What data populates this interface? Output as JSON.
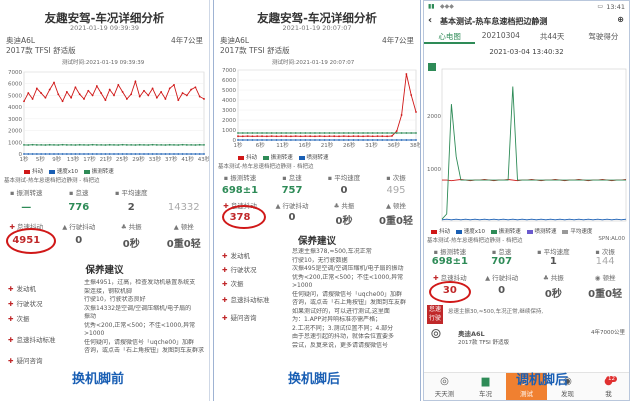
{
  "colors": {
    "red": "#d01818",
    "green": "#2e8b57",
    "blue": "#1a5fb4",
    "orange": "#f08030"
  },
  "panel1": {
    "title": "友趣安驾-车况详细分析",
    "date": "2021-01-19 09:39:39",
    "car": "奥迪A6L",
    "km": "4年7公里",
    "version": "2017款 TFSI 舒适版",
    "chart_caption": "测试时间:2021-01-19 09:39:39",
    "legend": [
      "抖动",
      "速度x10",
      "振测转速"
    ],
    "subnote": "基本测试-热车怠速档把边静测 - 档把边",
    "stat_labels": [
      "振测转速",
      "怠速",
      "平均速度",
      ""
    ],
    "stat_values": [
      "—",
      "776",
      "2",
      "14332"
    ],
    "metric_labels": [
      "怠速抖动",
      "行驶抖动",
      "共振",
      "顿挫"
    ],
    "metric_values": [
      "4951",
      "0",
      "0秒",
      "0重0轻"
    ],
    "advice_title": "保养建议",
    "advice_items": [
      "发动机",
      "行驶状况",
      "次振",
      "怠速抖动标准",
      "疑问咨询"
    ],
    "advice_text": [
      "主振4951，过高，检查发动机悬置系统支",
      "架连接，钢软机脚",
      "行驶10，行驶状态良好",
      "次振14332是空调/空调压缩机/电子扇的",
      "振动",
      "优秀<200,正常<500；不佳<1000,异常",
      ">1000",
      "任何疑问，请搜微信号「uqche00」加群",
      "咨询，或点击「右上角按钮」发图到车友群求"
    ],
    "caption": "换机脚前"
  },
  "panel2": {
    "title": "友趣安驾-车况详细分析",
    "date": "2021-01-19 20:07:07",
    "car": "奥迪A6L",
    "km": "4年7公里",
    "version": "2017款 TFSI 舒适版",
    "chart_caption": "测试时间:2021-01-19 20:07:07",
    "legend": [
      "抖动",
      "振测转速",
      "喷测转速"
    ],
    "subnote": "基本测试-热车怠速档把边静测 - 档把边",
    "stat_labels": [
      "振测转速",
      "怠速",
      "平均速度",
      "次振"
    ],
    "stat_values": [
      "698±1",
      "757",
      "0",
      "495"
    ],
    "metric_labels": [
      "怠速抖动",
      "行驶抖动",
      "共振",
      "顿挫"
    ],
    "metric_values": [
      "378",
      "0",
      "0秒",
      "0重0轻"
    ],
    "advice_title": "保养建议",
    "advice_items": [
      "发动机",
      "行驶状况",
      "次振",
      "怠速抖动标准",
      "疑问咨询"
    ],
    "advice_text": [
      "怠速主振378,≈500,车况正常",
      "行驶10，无行驶数据",
      "次振495是空调/空调压缩机/电子扇的振动",
      "优秀<200,正常<500；不佳<1000,异常",
      ">1000",
      "任何疑问，请搜微信号「uqche00」加群",
      "咨询，或点击「右上角按钮」发图到车友群",
      "如果测试好的，可以进行测试,这里面",
      "为：1.APP对异响标准亦需严格；",
      "2.工况不同；3.测试位置不同；4.部分",
      "由于怠速引起的抖动，就体会位置要多",
      "尝试，反复来说，更多请请搜微信号"
    ],
    "caption": "换机脚后"
  },
  "panel3": {
    "status_time": "13:41",
    "app_title": "基本测试-热车怠速档把边静测",
    "tabs": [
      "心电图",
      "20210304",
      "共44天",
      "驾驶得分"
    ],
    "date": "2021-03-04 13:40:32",
    "y_ticks": [
      "2000",
      "1000"
    ],
    "legend": [
      "抖动",
      "速度x10",
      "振测转速",
      "喷测转速",
      "平均速度"
    ],
    "subnote": "基本测试-热车怠速档把边静测 - 档把边",
    "sample_info": "SPN:AL00",
    "stat_labels": [
      "振测转速",
      "怠速",
      "平均速度",
      "次振"
    ],
    "stat_values": [
      "698±1",
      "707",
      "1",
      "144"
    ],
    "metric_labels": [
      "怠速抖动",
      "行驶抖动",
      "共振",
      "顿挫"
    ],
    "metric_values": [
      "30",
      "0",
      "0秒",
      "0重0轻"
    ],
    "tag_label": "怠速",
    "tag_label2": "行驶",
    "tag_text": "怠速主振30,≈500,车况正常,继续保持,",
    "car": "奥迪A6L",
    "km": "4年7000公里",
    "version": "2017款 TFSI 舒适版",
    "nav": [
      "天天测",
      "车况",
      "测试",
      "发现",
      "我"
    ],
    "nav_glyphs": [
      "◎",
      "🚗",
      "▷",
      "◉",
      "●"
    ],
    "badge": "12",
    "caption": "调机脚后"
  },
  "chart_data": [
    {
      "type": "line",
      "x_ticks": [
        "1秒",
        "5秒",
        "9秒",
        "13秒",
        "17秒",
        "21秒",
        "25秒",
        "29秒",
        "33秒",
        "37秒",
        "41秒",
        "43秒"
      ],
      "y_ticks": [
        "7000",
        "6000",
        "5000",
        "4000",
        "3000",
        "2000",
        "1000",
        "0"
      ],
      "ylim": [
        0,
        7000
      ],
      "series": [
        {
          "name": "抖动",
          "color": "#d01818",
          "values": [
            4500,
            5200,
            4700,
            5600,
            5200,
            4800,
            5500,
            6100,
            5100,
            4500,
            5300,
            4800,
            5700,
            5100,
            4700,
            5400,
            5000,
            5800,
            5200,
            4600,
            5500,
            5000,
            5900,
            5300,
            4700,
            5100,
            6200,
            4900,
            5400,
            5000,
            5600,
            4800,
            5300,
            4700,
            5600,
            5900,
            4600,
            5200,
            5000,
            5500,
            5700,
            4900,
            4700
          ]
        },
        {
          "name": "速度x10",
          "color": "#1a5fb4",
          "values": [
            0,
            0,
            0,
            0,
            0,
            0,
            0,
            0,
            0,
            0,
            0,
            0,
            0,
            0,
            0,
            0,
            0,
            0,
            0,
            0,
            0,
            0,
            0,
            0,
            0,
            0,
            0,
            0,
            0,
            0,
            0,
            0,
            0,
            0,
            0,
            0,
            0,
            0,
            0,
            0,
            0,
            0,
            0
          ]
        },
        {
          "name": "振测转速",
          "color": "#2e8b57",
          "values": [
            780,
            770,
            790,
            775,
            780,
            770,
            785,
            780,
            770,
            790,
            775,
            780,
            770,
            785,
            780,
            770,
            790,
            775,
            780,
            770,
            785,
            780,
            770,
            790,
            775,
            780,
            770,
            785,
            780,
            770,
            790,
            775,
            780,
            770,
            785,
            780,
            770,
            790,
            775,
            780,
            770,
            785,
            780
          ]
        }
      ]
    },
    {
      "type": "line",
      "x_ticks": [
        "1秒",
        "6秒",
        "11秒",
        "16秒",
        "21秒",
        "26秒",
        "31秒",
        "36秒",
        "38秒"
      ],
      "y_ticks": [
        "7000",
        "6000",
        "5000",
        "4000",
        "3000",
        "2000",
        "1000",
        "0"
      ],
      "ylim": [
        0,
        7000
      ],
      "series": [
        {
          "name": "抖动",
          "color": "#d01818",
          "values": [
            380,
            370,
            390,
            375,
            385,
            380,
            370,
            390,
            375,
            385,
            380,
            370,
            390,
            375,
            385,
            380,
            370,
            390,
            375,
            385,
            380,
            370,
            390,
            375,
            385,
            380,
            370,
            390,
            375,
            385,
            380,
            370,
            400,
            900,
            2500,
            6600,
            4500,
            2800
          ]
        },
        {
          "name": "振测转速",
          "color": "#2e8b57",
          "values": [
            700,
            698,
            702,
            699,
            701,
            698,
            700,
            702,
            699,
            701,
            698,
            700,
            702,
            699,
            701,
            698,
            700,
            702,
            699,
            701,
            698,
            700,
            702,
            699,
            701,
            698,
            700,
            702,
            699,
            701,
            698,
            700,
            702,
            699,
            701,
            698,
            700,
            702
          ]
        },
        {
          "name": "喷测转速",
          "color": "#1a5fb4",
          "values": [
            0,
            0,
            0,
            0,
            0,
            0,
            0,
            0,
            0,
            0,
            0,
            0,
            0,
            0,
            0,
            0,
            0,
            0,
            0,
            0,
            0,
            0,
            0,
            0,
            0,
            0,
            0,
            0,
            0,
            0,
            0,
            0,
            0,
            0,
            0,
            0,
            0,
            0
          ]
        }
      ]
    },
    {
      "type": "line",
      "ylim": [
        0,
        2600
      ],
      "series": [
        {
          "name": "抖动",
          "color": "#d01818",
          "values": [
            700,
            700,
            690,
            700,
            710,
            700,
            690,
            700,
            700,
            710,
            700,
            690,
            700,
            700,
            710,
            700,
            690,
            700,
            700,
            710,
            700,
            690,
            700,
            700,
            710,
            700,
            690,
            700,
            700,
            710,
            700,
            690,
            700,
            700,
            710,
            700,
            690,
            700,
            700,
            710
          ]
        },
        {
          "name": "振测转速",
          "color": "#2e8b57",
          "values": [
            30,
            120,
            2000,
            1100,
            700,
            700,
            700,
            700,
            700,
            700,
            700,
            700,
            700,
            700,
            700,
            2300,
            700,
            700,
            700,
            700,
            700,
            700,
            700,
            700,
            700,
            700,
            700,
            700,
            700,
            700,
            700,
            700,
            700,
            700,
            700,
            700,
            700,
            700,
            700,
            700
          ]
        },
        {
          "name": "速度x10",
          "color": "#1a5fb4",
          "values": [
            20,
            30,
            20,
            30,
            20,
            30,
            20,
            30,
            20,
            30,
            20,
            30,
            20,
            30,
            20,
            30,
            20,
            30,
            20,
            30,
            20,
            30,
            20,
            30,
            20,
            30,
            20,
            30,
            20,
            30,
            20,
            30,
            20,
            30,
            20,
            30,
            20,
            30,
            20,
            30
          ]
        }
      ]
    }
  ]
}
